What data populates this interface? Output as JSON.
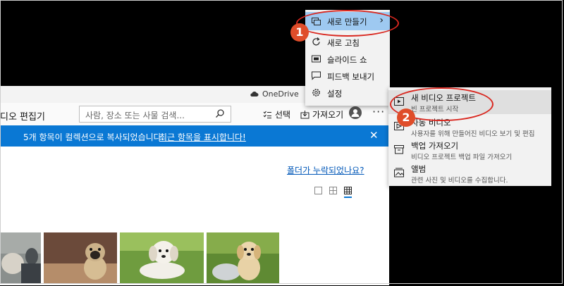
{
  "window": {
    "onedrive_label": "OneDrive",
    "app_title": "디오 편집기",
    "search_placeholder": "사람, 장소 또는 사물 검색...",
    "select_label": "선택",
    "import_label": "가져오기",
    "more_label": "···"
  },
  "banner": {
    "message": "5개 항목이 컬렉션으로 복사되었습니다.",
    "link": "최근 항목을 표시합니다!",
    "close": "✕"
  },
  "content": {
    "missing_folder_link": "폴더가 누락되었나요?",
    "photos": [
      {
        "name": "dog-with-person"
      },
      {
        "name": "pug-puppy"
      },
      {
        "name": "white-puppy-lying"
      },
      {
        "name": "puppy-in-bowl"
      }
    ]
  },
  "menu": {
    "items": [
      {
        "label": "새로 만들기",
        "icon": "new-icon"
      },
      {
        "label": "새로 고침",
        "icon": "refresh-icon"
      },
      {
        "label": "슬라이드 쇼",
        "icon": "slideshow-icon"
      },
      {
        "label": "피드백 보내기",
        "icon": "feedback-icon"
      },
      {
        "label": "설정",
        "icon": "gear-icon"
      }
    ],
    "chevron": "›"
  },
  "submenu": {
    "items": [
      {
        "title": "새 비디오 프로젝트",
        "subtitle": "빈 프로젝트 시작",
        "icon": "video-project-icon"
      },
      {
        "title": "자동 비디오",
        "subtitle": "사용자를 위해 만들어진 비디오 보기 및 편집",
        "icon": "auto-video-icon"
      },
      {
        "title": "백업 가져오기",
        "subtitle": "비디오 프로젝트 백업 파일 가져오기",
        "icon": "backup-icon"
      },
      {
        "title": "앨범",
        "subtitle": "관련 사진 및 비디오를 수집합니다.",
        "icon": "album-icon"
      }
    ]
  },
  "annotations": {
    "step1": "1",
    "step2": "2",
    "color": "#d9271f"
  },
  "colors": {
    "accent": "#0a78d4",
    "menu_highlight": "#9ec9f1"
  }
}
